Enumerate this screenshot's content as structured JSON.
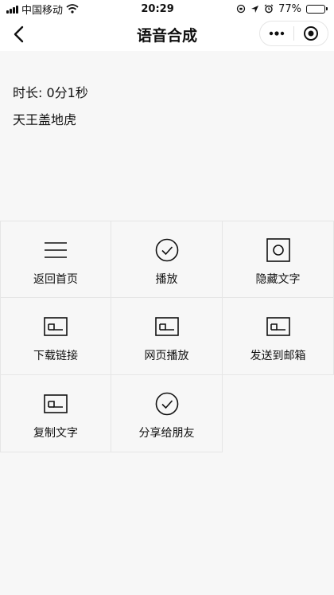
{
  "status_bar": {
    "carrier": "中国移动",
    "time": "20:29",
    "battery_text": "77%",
    "battery_level": 0.77
  },
  "nav": {
    "title": "语音合成"
  },
  "info": {
    "duration": "时长: 0分1秒",
    "text": "天王盖地虎"
  },
  "actions": [
    {
      "label": "返回首页",
      "icon": "menu-icon"
    },
    {
      "label": "播放",
      "icon": "check-circle-icon"
    },
    {
      "label": "隐藏文字",
      "icon": "record-icon"
    },
    {
      "label": "下载链接",
      "icon": "card-icon"
    },
    {
      "label": "网页播放",
      "icon": "card-icon"
    },
    {
      "label": "发送到邮箱",
      "icon": "card-icon"
    },
    {
      "label": "复制文字",
      "icon": "card-icon"
    },
    {
      "label": "分享给朋友",
      "icon": "check-circle-icon"
    }
  ]
}
